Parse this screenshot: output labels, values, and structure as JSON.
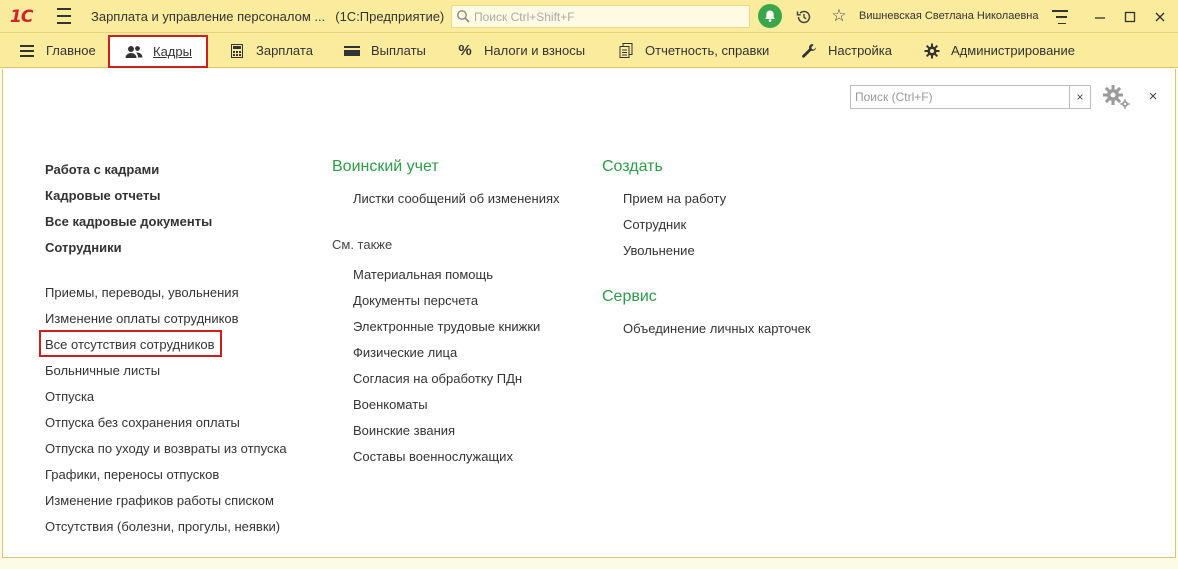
{
  "titlebar": {
    "logo": "1С",
    "app_name": "Зарплата и управление персоналом ...",
    "platform": "(1С:Предприятие)",
    "search_placeholder": "Поиск Ctrl+Shift+F",
    "user_name": "Вишневская Светлана Николаевна"
  },
  "sections": [
    {
      "label": "Главное",
      "icon": "menu-icon"
    },
    {
      "label": "Кадры",
      "icon": "people-icon",
      "active": true
    },
    {
      "label": "Зарплата",
      "icon": "calculator-icon"
    },
    {
      "label": "Выплаты",
      "icon": "wallet-icon"
    },
    {
      "label": "Налоги и взносы",
      "icon": "percent-icon"
    },
    {
      "label": "Отчетность, справки",
      "icon": "documents-icon"
    },
    {
      "label": "Настройка",
      "icon": "wrench-icon"
    },
    {
      "label": "Администрирование",
      "icon": "gear-icon"
    }
  ],
  "content": {
    "search_placeholder": "Поиск (Ctrl+F)",
    "clear_label": "×",
    "close_label": "×",
    "col1": {
      "main_links": [
        "Работа с кадрами",
        "Кадровые отчеты",
        "Все кадровые документы",
        "Сотрудники"
      ],
      "links": [
        "Приемы, переводы, увольнения",
        "Изменение оплаты сотрудников",
        "Все отсутствия сотрудников",
        "Больничные листы",
        "Отпуска",
        "Отпуска без сохранения оплаты",
        "Отпуска по уходу и возвраты из отпуска",
        "Графики, переносы отпусков",
        "Изменение графиков работы списком",
        "Отсутствия (болезни, прогулы, неявки)"
      ]
    },
    "col2": {
      "group_title": "Воинский учет",
      "group_links": [
        "Листки сообщений об изменениях"
      ],
      "see_also_label": "См. также",
      "see_also_links": [
        "Материальная помощь",
        "Документы персчета",
        "Электронные трудовые книжки",
        "Физические лица",
        "Согласия на обработку ПДн",
        "Военкоматы",
        "Воинские звания",
        "Составы военнослужащих"
      ]
    },
    "col3": {
      "create_title": "Создать",
      "create_links": [
        "Прием на работу",
        "Сотрудник",
        "Увольнение"
      ],
      "service_title": "Сервис",
      "service_links": [
        "Объединение личных карточек"
      ]
    }
  },
  "colors": {
    "header_bg": "#fbeb9d",
    "accent_green": "#2c9c48",
    "highlight_red": "#cc1f1f"
  }
}
